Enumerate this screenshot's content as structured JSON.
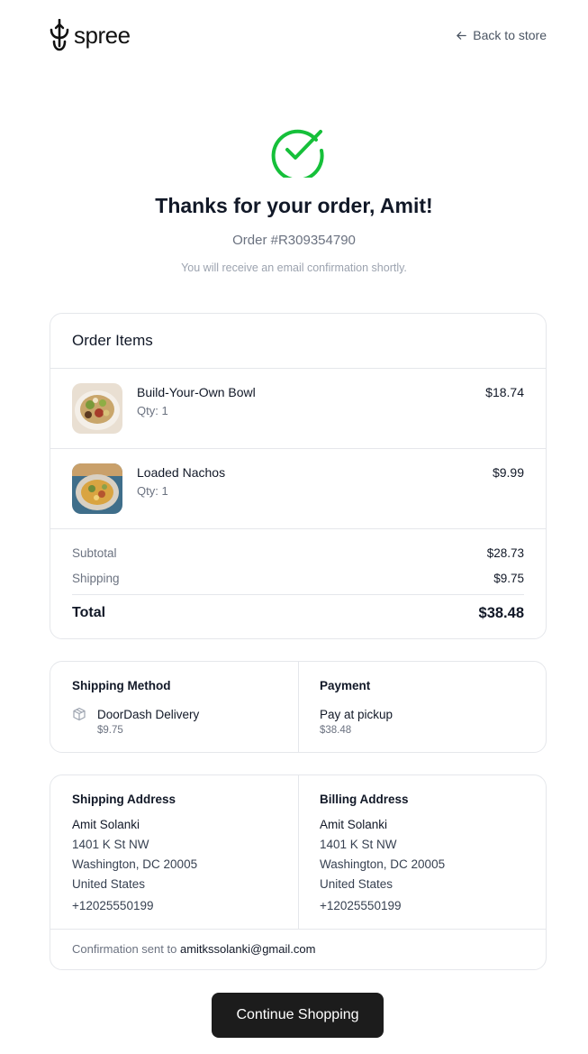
{
  "brand": {
    "name": "spree"
  },
  "nav": {
    "back_label": "Back to store"
  },
  "confirmation": {
    "title": "Thanks for your order, Amit!",
    "order_number": "Order #R309354790",
    "note": "You will receive an email confirmation shortly."
  },
  "order_items": {
    "title": "Order Items",
    "items": [
      {
        "name": "Build-Your-Own Bowl",
        "qty": "Qty: 1",
        "price": "$18.74"
      },
      {
        "name": "Loaded Nachos",
        "qty": "Qty: 1",
        "price": "$9.99"
      }
    ],
    "subtotal_label": "Subtotal",
    "subtotal": "$28.73",
    "shipping_label": "Shipping",
    "shipping": "$9.75",
    "total_label": "Total",
    "total": "$38.48"
  },
  "shipping_method": {
    "title": "Shipping Method",
    "name": "DoorDash Delivery",
    "price": "$9.75"
  },
  "payment": {
    "title": "Payment",
    "name": "Pay at pickup",
    "amount": "$38.48"
  },
  "shipping_address": {
    "title": "Shipping Address",
    "name": "Amit Solanki",
    "line1": "1401 K St NW",
    "line2": "Washington, DC 20005",
    "country": "United States",
    "phone": "+12025550199"
  },
  "billing_address": {
    "title": "Billing Address",
    "name": "Amit Solanki",
    "line1": "1401 K St NW",
    "line2": "Washington, DC 20005",
    "country": "United States",
    "phone": "+12025550199"
  },
  "confirmation_footer": {
    "prefix": "Confirmation sent to",
    "email": "amitkssolanki@gmail.com"
  },
  "cta": {
    "continue_label": "Continue Shopping"
  },
  "colors": {
    "success": "#16c03a",
    "primary_button": "#1c1c1c",
    "border": "#e5e7eb"
  }
}
